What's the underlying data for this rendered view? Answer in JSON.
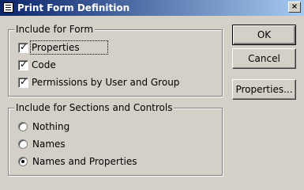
{
  "window": {
    "title": "Print Form Definition",
    "icon": "form-icon",
    "close_glyph": "×"
  },
  "group_form": {
    "title": "Include for Form",
    "items": [
      {
        "label": "Properties",
        "checked": true,
        "focused": true
      },
      {
        "label": "Code",
        "checked": true
      },
      {
        "label": "Permissions by User and Group",
        "checked": true
      }
    ]
  },
  "group_sections": {
    "title": "Include for Sections and Controls",
    "options": [
      {
        "label": "Nothing",
        "selected": false
      },
      {
        "label": "Names",
        "selected": false
      },
      {
        "label": "Names and Properties",
        "selected": true
      }
    ]
  },
  "buttons": {
    "ok": "OK",
    "cancel": "Cancel",
    "properties": "Properties..."
  },
  "check_glyph": "✓"
}
